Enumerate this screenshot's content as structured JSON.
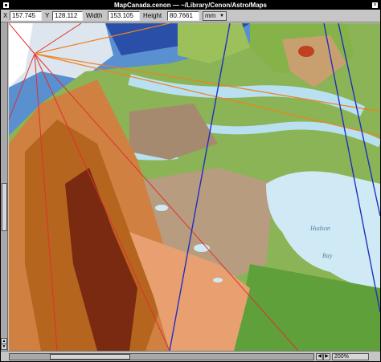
{
  "window": {
    "title": "MapCanada.cenon — ~/Library/Cenon/Astro/Maps",
    "close_glyph": "×"
  },
  "toolbar": {
    "x_label": "X",
    "x_value": "157.745",
    "y_label": "Y",
    "y_value": "128.112",
    "width_label": "Width",
    "width_value": "153.105",
    "height_label": "Height",
    "height_value": "80.7661",
    "unit": "mm"
  },
  "map": {
    "labels": [
      {
        "text": "Hudson"
      },
      {
        "text": "Bay"
      }
    ]
  },
  "status": {
    "zoom": "200%"
  },
  "icons": {
    "miniaturize": "miniaturize-icon",
    "close": "close-icon",
    "dropdown": "chevron-down-icon",
    "scroll_up": "arrow-up-icon",
    "scroll_down": "arrow-down-icon",
    "scroll_left": "arrow-left-icon",
    "scroll_right": "arrow-right-icon"
  },
  "colors": {
    "ocean": "#5a8fd0",
    "shallow_water": "#b8e0f0",
    "lowland_green": "#7cb342",
    "tundra_tan": "#b89c80",
    "mountains_brown": "#b5651d",
    "line_red": "#e03030",
    "line_blue": "#2030c0",
    "line_orange": "#f08020"
  }
}
